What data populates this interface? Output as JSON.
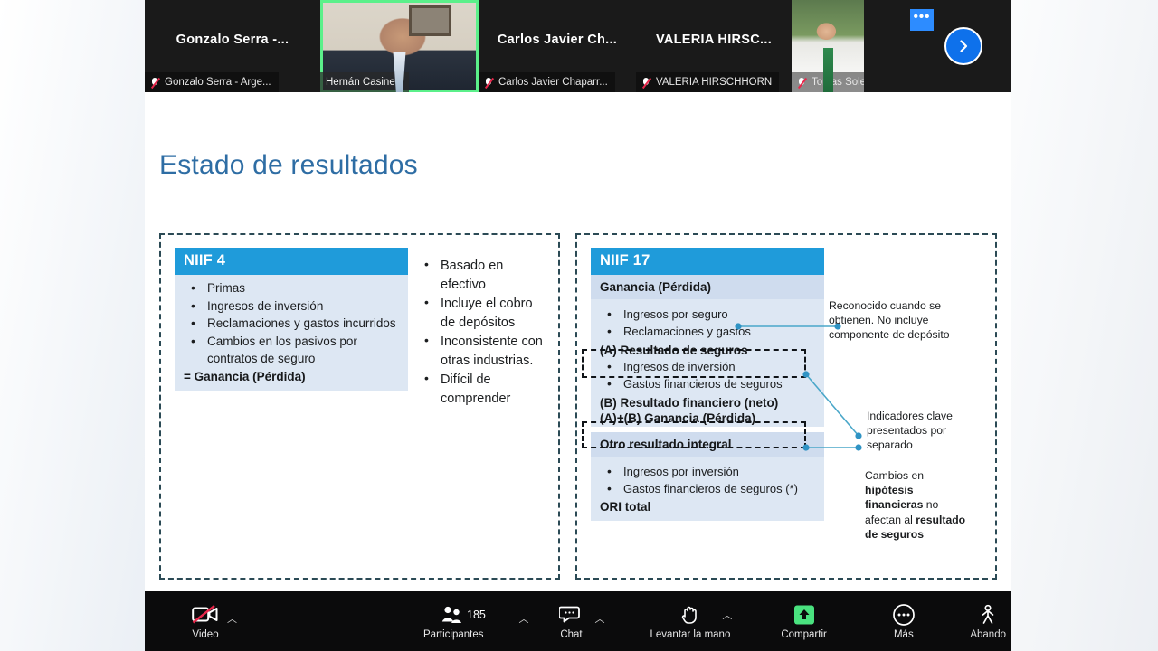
{
  "meeting": {
    "participants_strip": [
      {
        "big_label": "Gonzalo Serra -...",
        "name": "Gonzalo Serra - Arge...",
        "muted": true,
        "active": false,
        "has_video": false
      },
      {
        "big_label": "",
        "name": "Hernán Casinelli",
        "muted": false,
        "active": true,
        "has_video": true
      },
      {
        "big_label": "Carlos Javier Ch...",
        "name": "Carlos Javier Chaparr...",
        "muted": true,
        "active": false,
        "has_video": false
      },
      {
        "big_label": "VALERIA HIRSC...",
        "name": "VALERIA HIRSCHHORN",
        "muted": true,
        "active": false,
        "has_video": false
      },
      {
        "big_label": "",
        "name": "Tomas Soley",
        "muted": true,
        "active": false,
        "has_video": true
      }
    ],
    "more_button_label": "•••",
    "next_page_icon": "chevron-right-icon"
  },
  "slide": {
    "title": "Estado de resultados",
    "left_panel": {
      "card": {
        "header": "NIIF 4",
        "bullets": [
          "Primas",
          "Ingresos de inversión",
          "Reclamaciones y gastos incurridos",
          "Cambios en los pasivos por contratos de seguro"
        ],
        "total": "= Ganancia (Pérdida)"
      },
      "notes": [
        "Basado en efectivo",
        "Incluye el cobro de depósitos",
        "Inconsistente con otras industrias.",
        "Difícil de comprender"
      ]
    },
    "right_panel": {
      "card": {
        "header": "NIIF 17",
        "section1_title": "Ganancia (Pérdida)",
        "section1_bullets": [
          "Ingresos por seguro",
          "Reclamaciones y gastos"
        ],
        "subtotal_a": "(A) Resultado de seguros",
        "section2_bullets": [
          "Ingresos de inversión",
          "Gastos financieros de seguros"
        ],
        "subtotal_b": "(B) Resultado financiero (neto)",
        "total_ab": "(A)+(B) Ganancia (Pérdida)",
        "section3_title": "Otro resultado integral",
        "section3_bullets": [
          "Ingresos por inversión",
          "Gastos financieros de seguros (*)"
        ],
        "total_ori": "ORI total"
      },
      "annotations": [
        {
          "id": "anno-recognized",
          "text": "Reconocido cuando se obtienen. No incluye componente de depósito"
        },
        {
          "id": "anno-indicators",
          "text": "Indicadores clave presentados por separado"
        },
        {
          "id": "anno-hypotheses",
          "parts": [
            {
              "text": "Cambios en ",
              "bold": false
            },
            {
              "text": "hipótesis financieras",
              "bold": true
            },
            {
              "text": " no afectan al ",
              "bold": false
            },
            {
              "text": "resultado de seguros",
              "bold": true
            }
          ]
        }
      ]
    },
    "colors": {
      "header_blue": "#1f9bda",
      "body_blue": "#dde7f3",
      "sub_blue": "#cfdcee",
      "title_blue": "#2e6da4",
      "dash_border": "#2b4a55",
      "connector": "#4aa7c9"
    }
  },
  "toolbar": {
    "items": [
      {
        "id": "video",
        "label": "Video",
        "icon": "video-off-icon",
        "caret": true,
        "count": null
      },
      {
        "id": "participants",
        "label": "Participantes",
        "icon": "participants-icon",
        "caret": true,
        "count": "185"
      },
      {
        "id": "chat",
        "label": "Chat",
        "icon": "chat-icon",
        "caret": true,
        "count": null
      },
      {
        "id": "raise-hand",
        "label": "Levantar la mano",
        "icon": "raise-hand-icon",
        "caret": true,
        "count": null
      },
      {
        "id": "share",
        "label": "Compartir",
        "icon": "share-screen-icon",
        "caret": false,
        "count": null
      },
      {
        "id": "more",
        "label": "Más",
        "icon": "ellipsis-icon",
        "caret": false,
        "count": null
      }
    ],
    "leave": {
      "label": "Abando",
      "icon": "leave-meeting-icon"
    }
  }
}
